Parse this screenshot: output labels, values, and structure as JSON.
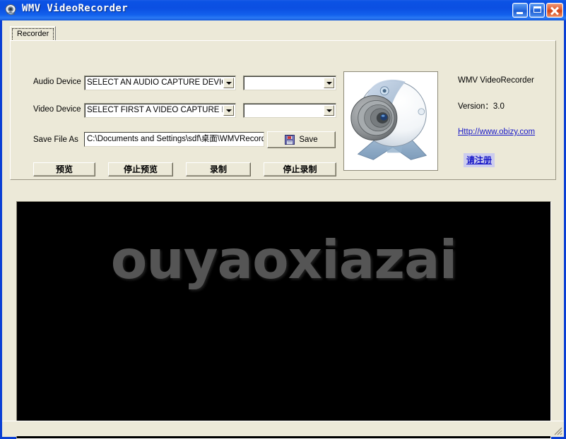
{
  "window": {
    "title": "WMV VideoRecorder",
    "icon": "webcam-icon",
    "minimize_label": "Minimize",
    "maximize_label": "Maximize",
    "close_label": "Close"
  },
  "tabs": [
    {
      "label": "Recorder",
      "selected": true
    }
  ],
  "form": {
    "audio_device": {
      "label": "Audio Device",
      "value": "SELECT AN AUDIO CAPTURE DEVICE",
      "secondary_value": ""
    },
    "video_device": {
      "label": "Video Device",
      "value": "SELECT FIRST A VIDEO CAPTURE DEV",
      "secondary_value": ""
    },
    "save_file": {
      "label": "Save File As",
      "value": "C:\\Documents and Settings\\sdf\\桌面\\WMVRecord",
      "button_label": "Save"
    }
  },
  "actions": {
    "preview": "预览",
    "stop_preview": "停止预览",
    "record": "录制",
    "stop_record": "停止录制"
  },
  "info": {
    "product": "WMV VideoRecorder",
    "version": "Version：3.0",
    "url": "Http://www.obizy.com",
    "register": "请注册"
  },
  "preview": {
    "watermark": "ouyaoxiazai",
    "background": "#000000"
  },
  "colors": {
    "titlebar_blue": "#0b4fe2",
    "face": "#ece9d8",
    "link": "#1818c8",
    "register_highlight": "#ccccee",
    "watermark_gray": "#555555"
  }
}
